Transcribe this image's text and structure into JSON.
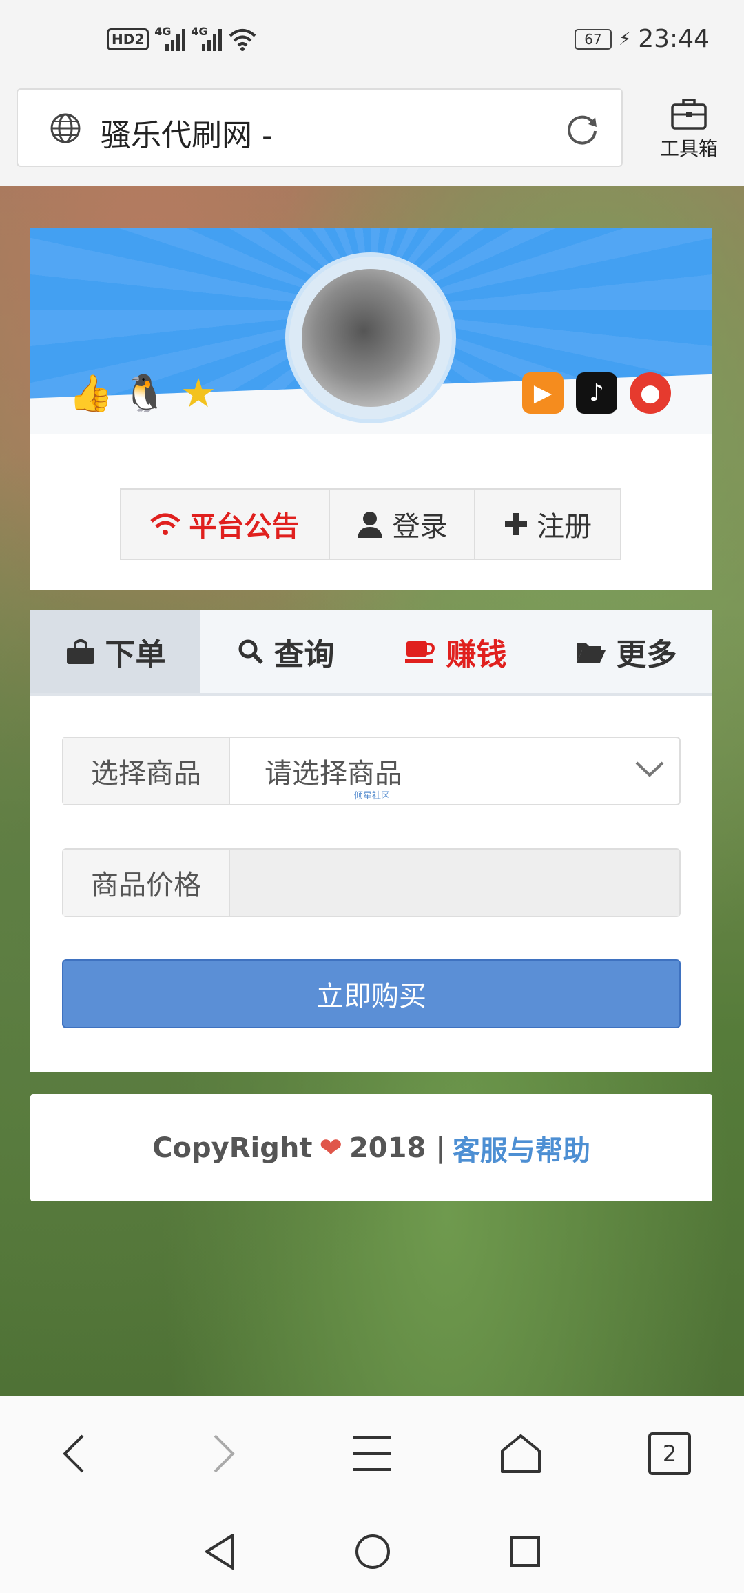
{
  "status_bar": {
    "network": "HD2",
    "signal1": "4G",
    "signal2": "4G",
    "battery": "67",
    "time": "23:44"
  },
  "browser": {
    "page_title": "骚乐代刷网 -",
    "toolbox_label": "工具箱",
    "tabs_count": "2"
  },
  "header": {
    "buttons": {
      "notice": "平台公告",
      "login": "登录",
      "register": "注册"
    }
  },
  "order": {
    "tabs": {
      "order": "下单",
      "query": "查询",
      "earn": "赚钱",
      "more": "更多"
    },
    "product_label": "选择商品",
    "product_placeholder": "请选择商品",
    "watermark": "倾星社区",
    "price_label": "商品价格",
    "price_value": "",
    "buy_button": "立即购买"
  },
  "footer": {
    "copyright": "CopyRight",
    "year": "2018 |",
    "help_link": "客服与帮助"
  }
}
